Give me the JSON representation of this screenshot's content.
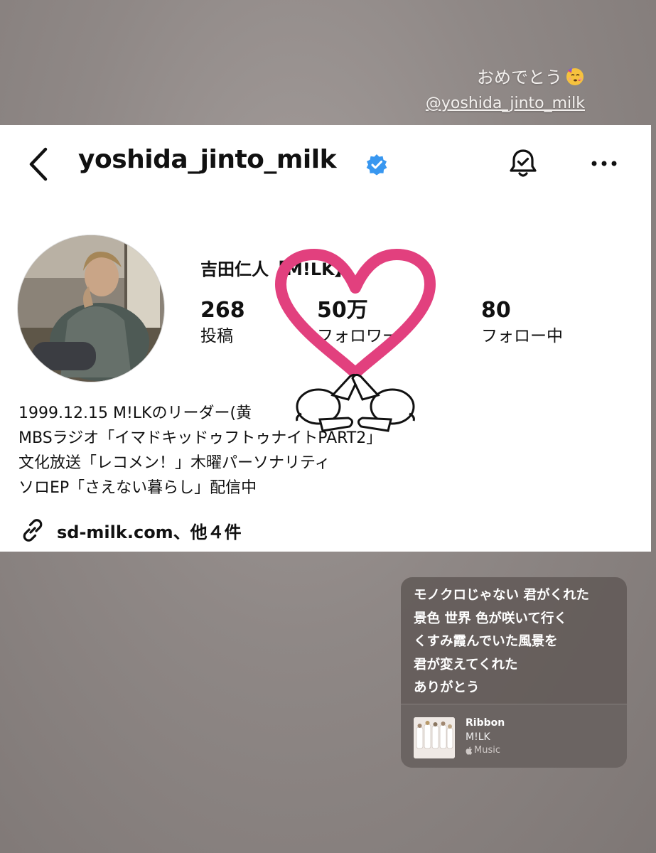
{
  "story": {
    "caption": "おめでとう",
    "caption_emoji": "partying-face-icon",
    "mention": "@yoshida_jinto_milk"
  },
  "profile": {
    "username": "yoshida_jinto_milk",
    "verified": true,
    "display_name": "吉田仁人【M!LK】",
    "stats": [
      {
        "value": "268",
        "label": "投稿"
      },
      {
        "value": "50万",
        "label": "フォロワー"
      },
      {
        "value": "80",
        "label": "フォロー中"
      }
    ],
    "bio": [
      "1999.12.15 M!LKのリーダー(黄",
      "MBSラジオ「イマドキッドゥフトゥナイトPART2」",
      "文化放送「レコメン！」木曜パーソナリティ",
      "ソロEP「さえない暮らし」配信中"
    ],
    "link": "sd-milk.com、他４件"
  },
  "sticker": {
    "type": "heart-hands",
    "color": "#e2407e"
  },
  "music": {
    "lyrics": [
      "モノクロじゃない 君がくれた",
      "景色 世界 色が咲いて行く",
      "くすみ霞んでいた風景を",
      "君が変えてくれた",
      "ありがとう"
    ],
    "track": "Ribbon",
    "artist": "M!LK",
    "service": "Music"
  },
  "colors": {
    "verified": "#3897f0",
    "heart": "#e2407e",
    "card_bg": "#ffffff"
  }
}
